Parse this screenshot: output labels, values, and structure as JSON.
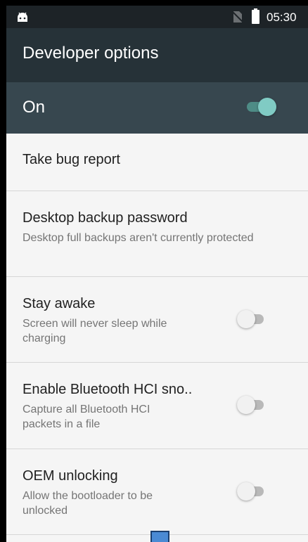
{
  "status_bar": {
    "time": "05:30",
    "icons": [
      "android-icon",
      "no-sim-icon",
      "battery-icon"
    ]
  },
  "app_bar": {
    "title": "Developer options"
  },
  "master_switch": {
    "label": "On",
    "checked": true,
    "accent_color": "#80cbc4"
  },
  "settings": [
    {
      "title": "Take bug report",
      "summary": "",
      "has_switch": false
    },
    {
      "title": "Desktop backup password",
      "summary": "Desktop full backups aren't currently protected",
      "has_switch": false
    },
    {
      "title": "Stay awake",
      "summary": "Screen will never sleep while charging",
      "has_switch": true,
      "checked": false
    },
    {
      "title": "Enable Bluetooth HCI sno..",
      "summary": "Capture all Bluetooth HCI packets in a file",
      "has_switch": true,
      "checked": false
    },
    {
      "title": "OEM unlocking",
      "summary": "Allow the bootloader to be unlocked",
      "has_switch": true,
      "checked": false
    }
  ],
  "colors": {
    "status_bar": "#1d2327",
    "app_bar": "#263238",
    "master_bar": "#37474f",
    "background": "#f5f5f5"
  }
}
